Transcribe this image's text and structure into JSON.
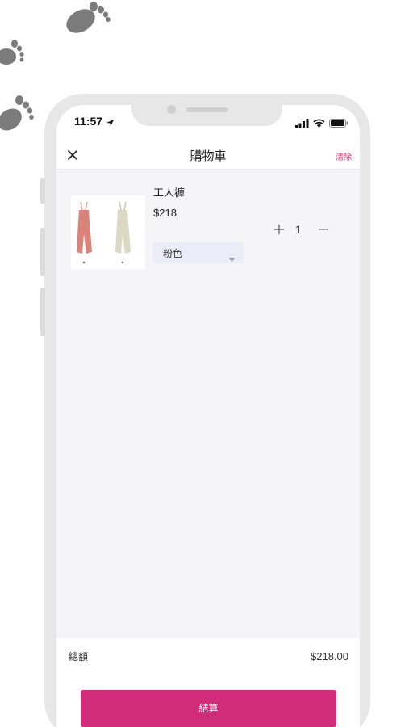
{
  "status_bar": {
    "time": "11:57"
  },
  "nav": {
    "title": "購物車",
    "clear_label": "清除"
  },
  "cart": {
    "items": [
      {
        "name": "工人褲",
        "price": "$218",
        "quantity": "1",
        "color": "粉色"
      }
    ]
  },
  "footer": {
    "total_label": "總額",
    "total_value": "$218.00",
    "checkout_label": "結算"
  },
  "colors": {
    "accent": "#d02c7a",
    "select_bg": "#eaedf7",
    "screen_bg": "#f5f5f7",
    "frame": "#e7e7e7",
    "footprint": "#7a7a7a"
  }
}
